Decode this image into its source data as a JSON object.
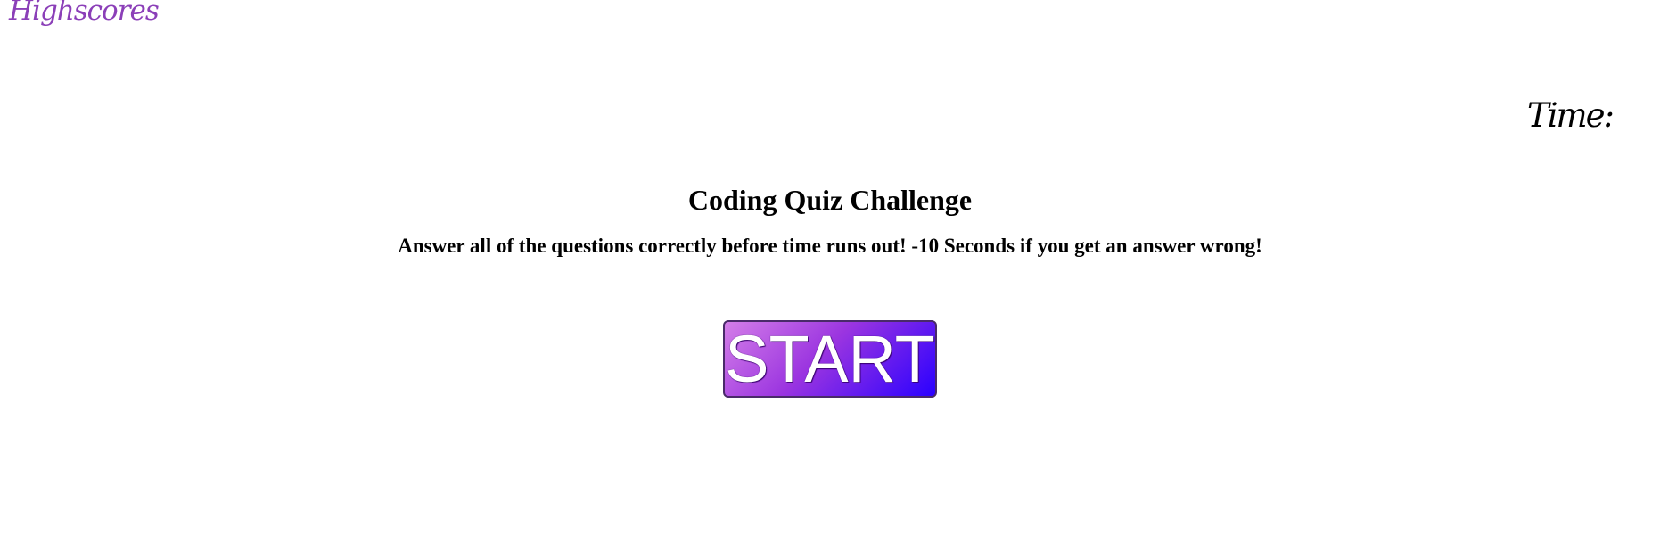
{
  "nav": {
    "highscores_label": "Highscores"
  },
  "timer": {
    "label": "Time:",
    "value": ""
  },
  "main": {
    "title": "Coding Quiz Challenge",
    "instructions": "Answer all of the questions correctly before time runs out! -10 Seconds if you get an answer wrong!",
    "start_label": "START"
  },
  "colors": {
    "highscores_link": "#8b3fb8",
    "start_gradient_start": "#d47ee8",
    "start_gradient_end": "#2a00ff"
  }
}
